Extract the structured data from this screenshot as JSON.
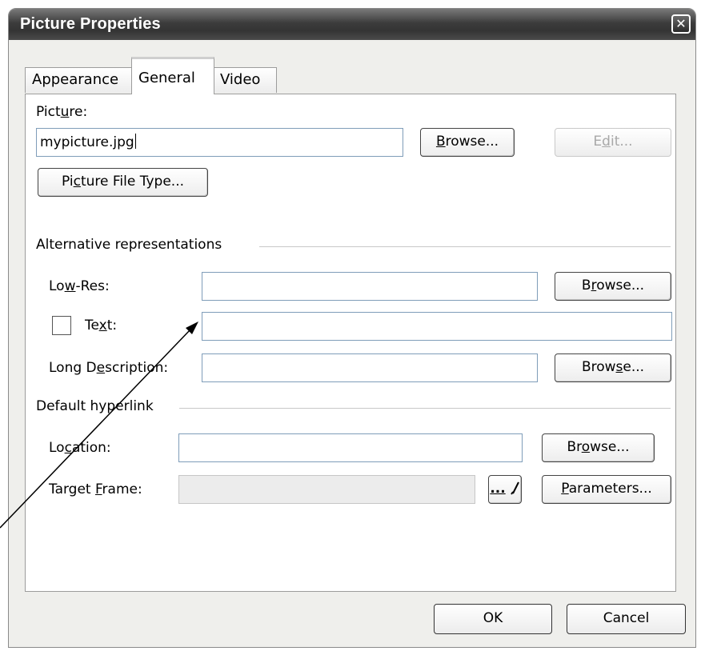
{
  "window": {
    "title": "Picture Properties",
    "close_glyph": "✕"
  },
  "tabs": [
    {
      "label": "Appearance",
      "active": false
    },
    {
      "label": "General",
      "active": true
    },
    {
      "label": "Video",
      "active": false
    }
  ],
  "picture": {
    "label_pre": "Pict",
    "label_key": "u",
    "label_post": "re:",
    "value": "mypicture.jpg",
    "browse_pre": "",
    "browse_key": "B",
    "browse_post": "rowse...",
    "edit_pre": "E",
    "edit_key": "d",
    "edit_post": "it...",
    "filetype_pre": "Pi",
    "filetype_key": "c",
    "filetype_post": "ture File Type..."
  },
  "alternative": {
    "heading": "Alternative representations",
    "lowres_pre": "Lo",
    "lowres_key": "w",
    "lowres_post": "-Res:",
    "lowres_value": "",
    "lowres_browse_pre": "B",
    "lowres_browse_key": "r",
    "lowres_browse_post": "owse...",
    "text_pre": "Te",
    "text_key": "x",
    "text_post": "t:",
    "text_checked": false,
    "text_value": "",
    "longdesc_pre": "Long D",
    "longdesc_key": "e",
    "longdesc_post": "scription:",
    "longdesc_value": "",
    "longdesc_browse_pre": "Brow",
    "longdesc_browse_key": "s",
    "longdesc_browse_post": "e..."
  },
  "hyperlink": {
    "heading": "Default hyperlink",
    "location_pre": "Lo",
    "location_key": "c",
    "location_post": "ation:",
    "location_value": "",
    "location_browse_pre": "Br",
    "location_browse_key": "o",
    "location_browse_post": "wse...",
    "target_pre": "Target ",
    "target_key": "F",
    "target_post": "rame:",
    "target_value": "",
    "target_picker_label": "...",
    "parameters_pre": "",
    "parameters_key": "P",
    "parameters_post": "arameters..."
  },
  "footer": {
    "ok_label": "OK",
    "cancel_label": "Cancel"
  },
  "colors": {
    "titlebar": "#3c3c3c",
    "dialog": "#efefec",
    "panel": "#ffffff"
  }
}
